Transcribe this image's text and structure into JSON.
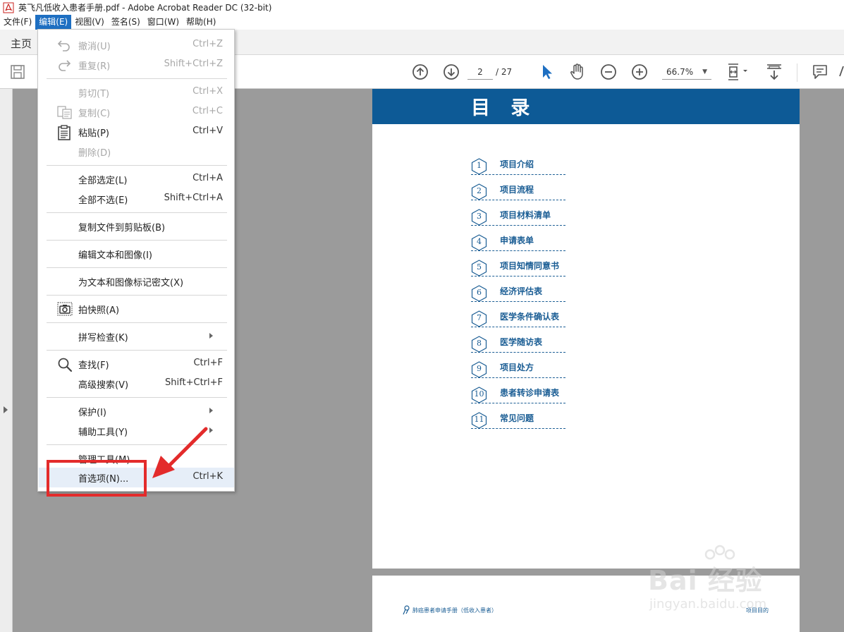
{
  "window": {
    "title": "英飞凡低收入患者手册.pdf - Adobe Acrobat Reader DC (32-bit)"
  },
  "menubar": [
    {
      "label": "文件(F)",
      "active": false
    },
    {
      "label": "编辑(E)",
      "active": true
    },
    {
      "label": "视图(V)",
      "active": false
    },
    {
      "label": "签名(S)",
      "active": false
    },
    {
      "label": "窗口(W)",
      "active": false
    },
    {
      "label": "帮助(H)",
      "active": false
    }
  ],
  "tabs": {
    "home": "主页"
  },
  "toolbar": {
    "current_page": "2",
    "total_pages": "/ 27",
    "zoom": "66.7%"
  },
  "edit_menu": {
    "items": [
      {
        "label": "撤消(U)",
        "shortcut": "Ctrl+Z",
        "disabled": true,
        "icon": "undo-icon"
      },
      {
        "label": "重复(R)",
        "shortcut": "Shift+Ctrl+Z",
        "disabled": true,
        "icon": "redo-icon"
      },
      {
        "label": "剪切(T)",
        "shortcut": "Ctrl+X",
        "disabled": true,
        "icon": ""
      },
      {
        "label": "复制(C)",
        "shortcut": "Ctrl+C",
        "disabled": true,
        "icon": "copy-icon"
      },
      {
        "label": "粘贴(P)",
        "shortcut": "Ctrl+V",
        "disabled": false,
        "icon": "paste-icon"
      },
      {
        "label": "删除(D)",
        "shortcut": "",
        "disabled": true,
        "icon": ""
      },
      {
        "label": "全部选定(L)",
        "shortcut": "Ctrl+A",
        "disabled": false,
        "icon": ""
      },
      {
        "label": "全部不选(E)",
        "shortcut": "Shift+Ctrl+A",
        "disabled": false,
        "icon": ""
      },
      {
        "label": "复制文件到剪贴板(B)",
        "shortcut": "",
        "disabled": false,
        "icon": ""
      },
      {
        "label": "编辑文本和图像(I)",
        "shortcut": "",
        "disabled": false,
        "icon": ""
      },
      {
        "label": "为文本和图像标记密文(X)",
        "shortcut": "",
        "disabled": false,
        "icon": ""
      },
      {
        "label": "拍快照(A)",
        "shortcut": "",
        "disabled": false,
        "icon": "camera-icon"
      },
      {
        "label": "拼写检查(K)",
        "shortcut": "",
        "disabled": false,
        "icon": "",
        "submenu": true
      },
      {
        "label": "查找(F)",
        "shortcut": "Ctrl+F",
        "disabled": false,
        "icon": "search-icon"
      },
      {
        "label": "高级搜索(V)",
        "shortcut": "Shift+Ctrl+F",
        "disabled": false,
        "icon": ""
      },
      {
        "label": "保护(I)",
        "shortcut": "",
        "disabled": false,
        "icon": "",
        "submenu": true
      },
      {
        "label": "辅助工具(Y)",
        "shortcut": "",
        "disabled": false,
        "icon": "",
        "submenu": true
      },
      {
        "label": "管理工具(M)",
        "shortcut": "",
        "disabled": false,
        "icon": ""
      },
      {
        "label": "首选项(N)...",
        "shortcut": "Ctrl+K",
        "disabled": false,
        "icon": "",
        "highlight": true
      }
    ]
  },
  "document": {
    "toc_title": "目 录",
    "toc_items": [
      {
        "num": "1",
        "label": "项目介绍"
      },
      {
        "num": "2",
        "label": "项目流程"
      },
      {
        "num": "3",
        "label": "项目材料清单"
      },
      {
        "num": "4",
        "label": "申请表单"
      },
      {
        "num": "5",
        "label": "项目知情同意书"
      },
      {
        "num": "6",
        "label": "经济评估表"
      },
      {
        "num": "7",
        "label": "医学条件确认表"
      },
      {
        "num": "8",
        "label": "医学随访表"
      },
      {
        "num": "9",
        "label": "项目处方"
      },
      {
        "num": "10",
        "label": "患者转诊申请表"
      },
      {
        "num": "11",
        "label": "常见问题"
      }
    ],
    "page2_footer_left": "肺癌患者申请手册（低收入患者）",
    "page2_footer_right": "项目目的"
  },
  "watermark": {
    "main": "Bai 经验",
    "url": "jingyan.baidu.com"
  },
  "colors": {
    "accent": "#1e6fc2",
    "doc_blue": "#0d5a96",
    "annotation_red": "#e32b2b"
  }
}
